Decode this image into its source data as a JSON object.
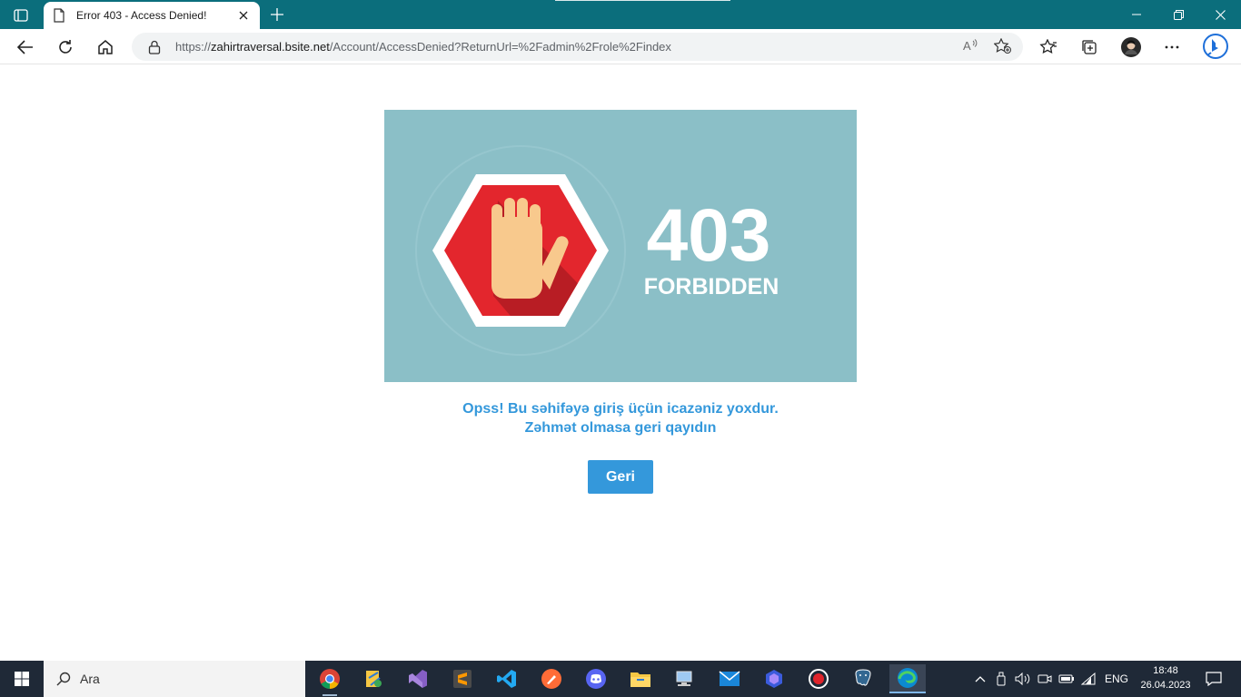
{
  "browser": {
    "tab": {
      "title": "Error 403 - Access Denied!"
    },
    "url": {
      "scheme": "https://",
      "host": "zahirtraversal.bsite.net",
      "path": "/Account/AccessDenied?ReturnUrl=%2Fadmin%2Frole%2Findex"
    },
    "read_aloud": "Aᴬ"
  },
  "hero": {
    "code": "403",
    "label": "FORBIDDEN",
    "bg_color": "#8bbfc7",
    "octagon_color": "#e3262d"
  },
  "message": {
    "line1": "Opss! Bu səhifəyə giriş üçün icazəniz yoxdur.",
    "line2": "Zəhmət olmasa geri qayıdın"
  },
  "back_button": {
    "label": "Geri",
    "color": "#3498db"
  },
  "taskbar": {
    "search_placeholder": "Ara",
    "apps": [
      "chrome-icon",
      "file-tool-icon",
      "visual-studio-icon",
      "sublime-text-icon",
      "postman-icon",
      "vscode-icon",
      "discord-icon",
      "file-explorer-icon",
      "network-tool-icon",
      "mail-icon",
      "copilot-icon",
      "recorder-icon",
      "postgresql-icon",
      "edge-icon"
    ],
    "language": "ENG",
    "time": "18:48",
    "date": "26.04.2023"
  }
}
